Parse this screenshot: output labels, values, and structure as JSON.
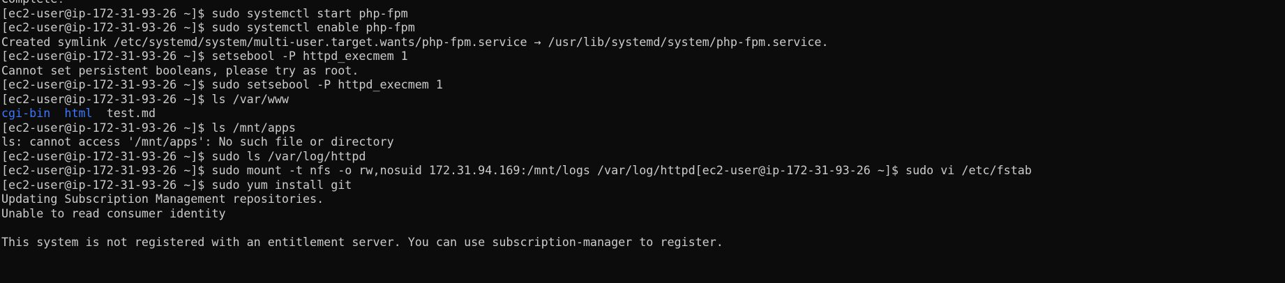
{
  "theme": {
    "background": "#0c0c0c",
    "foreground": "#cccccc",
    "directory_color": "#3b78ff"
  },
  "terminal": {
    "lines": [
      "Complete!",
      "[ec2-user@ip-172-31-93-26 ~]$ sudo systemctl start php-fpm",
      "[ec2-user@ip-172-31-93-26 ~]$ sudo systemctl enable php-fpm",
      "Created symlink /etc/systemd/system/multi-user.target.wants/php-fpm.service → /usr/lib/systemd/system/php-fpm.service.",
      "[ec2-user@ip-172-31-93-26 ~]$ setsebool -P httpd_execmem 1",
      "Cannot set persistent booleans, please try as root.",
      "[ec2-user@ip-172-31-93-26 ~]$ sudo setsebool -P httpd_execmem 1",
      "[ec2-user@ip-172-31-93-26 ~]$ ls /var/www",
      {
        "segments": [
          {
            "text": "cgi-bin",
            "kind": "dir"
          },
          {
            "text": "  ",
            "kind": "plain"
          },
          {
            "text": "html",
            "kind": "dir"
          },
          {
            "text": "  test.md",
            "kind": "plain"
          }
        ]
      },
      "[ec2-user@ip-172-31-93-26 ~]$ ls /mnt/apps",
      "ls: cannot access '/mnt/apps': No such file or directory",
      "[ec2-user@ip-172-31-93-26 ~]$ sudo ls /var/log/httpd",
      "[ec2-user@ip-172-31-93-26 ~]$ sudo mount -t nfs -o rw,nosuid 172.31.94.169:/mnt/logs /var/log/httpd[ec2-user@ip-172-31-93-26 ~]$ sudo vi /etc/fstab",
      "[ec2-user@ip-172-31-93-26 ~]$ sudo yum install git",
      "Updating Subscription Management repositories.",
      "Unable to read consumer identity",
      "",
      "This system is not registered with an entitlement server. You can use subscription-manager to register."
    ]
  }
}
